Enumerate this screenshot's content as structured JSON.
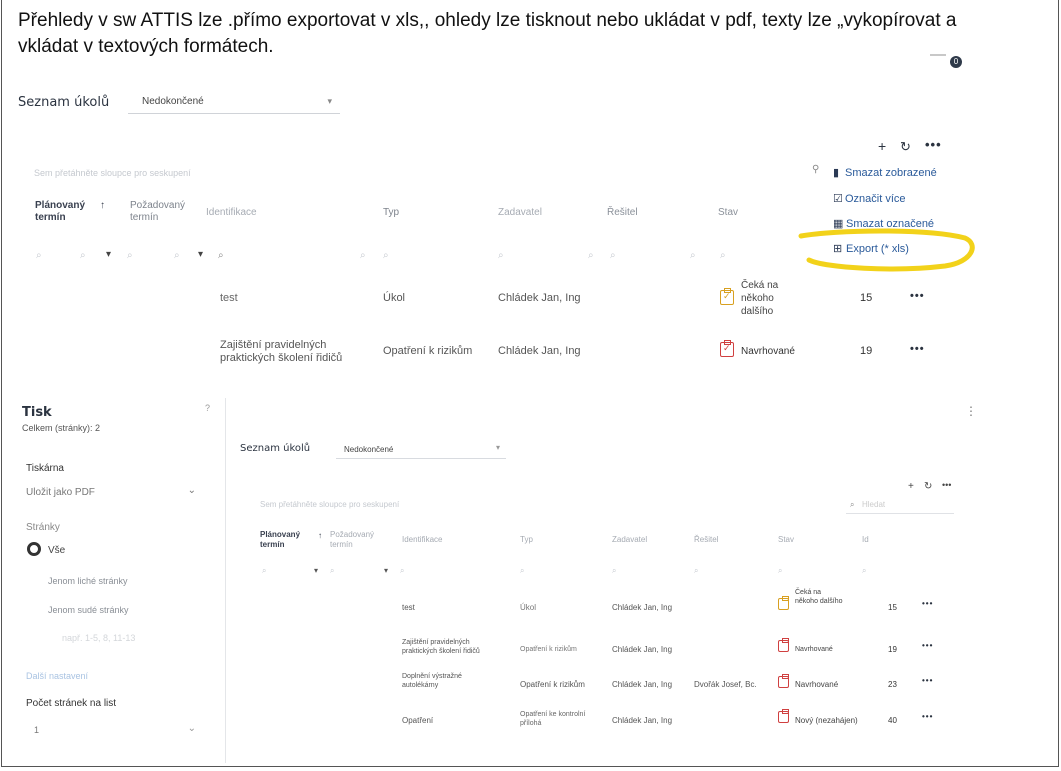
{
  "caption": "Přehledy v sw ATTIS lze .přímo exportovat v xls,, ohledy lze tisknout nebo ukládat v pdf, texty lze „vykopírovat a vkládat v textových formátech.",
  "badge": "0",
  "top": {
    "list_title": "Seznam úkolů",
    "filter_value": "Nedokončené",
    "group_hint": "Sem přetáhněte sloupce pro seskupení",
    "columns": [
      "Plánovaný termín",
      "Požadovaný termín",
      "Identifikace",
      "Typ",
      "Zadavatel",
      "Řešitel",
      "Stav"
    ],
    "sort_mark": "↑",
    "menu": [
      "Smazat zobrazené",
      "Označit více",
      "Smazat označené",
      "Export (* xls)"
    ],
    "rows": [
      {
        "ident": "test",
        "type": "Úkol",
        "assigner": "Chládek Jan, Ing",
        "status": "Čeká na někoho dalšího",
        "id": "15"
      },
      {
        "ident": "Zajištění pravidelných praktických školení řidičů",
        "type": "Opatření k rizikům",
        "assigner": "Chládek Jan, Ing",
        "status": "Navrhované",
        "id": "19"
      }
    ]
  },
  "print": {
    "title": "Tisk",
    "subtitle": "Celkem (stránky): 2",
    "printer_label": "Tiskárna",
    "printer_value": "Uložit jako PDF",
    "pages_label": "Stránky",
    "opt_all": "Vše",
    "opt_odd": "Jenom liché stránky",
    "opt_even": "Jenom sudé stránky",
    "opt_range": "např. 1-5, 8, 11-13",
    "more": "Další nastavení",
    "per_sheet_label": "Počet stránek na list",
    "per_sheet_value": "1"
  },
  "preview": {
    "list_title": "Seznam úkolů",
    "filter_value": "Nedokončené",
    "group_hint": "Sem přetáhněte sloupce pro seskupení",
    "search_placeholder": "Hledat",
    "columns": [
      "Plánovaný termín",
      "Požadovaný termín",
      "Identifikace",
      "Typ",
      "Zadavatel",
      "Řešitel",
      "Stav",
      "Id"
    ],
    "rows": [
      {
        "ident": "test",
        "type": "Úkol",
        "assigner": "Chládek Jan, Ing",
        "solver": "",
        "status": "Čeká na někoho dalšího",
        "id": "15",
        "red": false
      },
      {
        "ident": "Zajištění pravidelných praktických školení řidičů",
        "type": "Opatření k rizikům",
        "assigner": "Chládek Jan, Ing",
        "solver": "",
        "status": "Navrhované",
        "id": "19",
        "red": true
      },
      {
        "ident": "Doplnění výstražné autolékárny",
        "type": "Opatření k rizikům",
        "assigner": "Chládek Jan, Ing",
        "solver": "Dvořák Josef, Bc.",
        "status": "Navrhované",
        "id": "23",
        "red": true
      },
      {
        "ident": "Opatření",
        "type": "Opatření ke kontrolní přílohá",
        "assigner": "Chládek Jan, Ing",
        "solver": "",
        "status": "Nový (nezahájen)",
        "id": "40",
        "red": true
      }
    ]
  },
  "colors": {
    "accent": "#3a7ec8",
    "highlight": "#f2d21a",
    "warn": "#d8a020",
    "danger": "#d04040"
  }
}
